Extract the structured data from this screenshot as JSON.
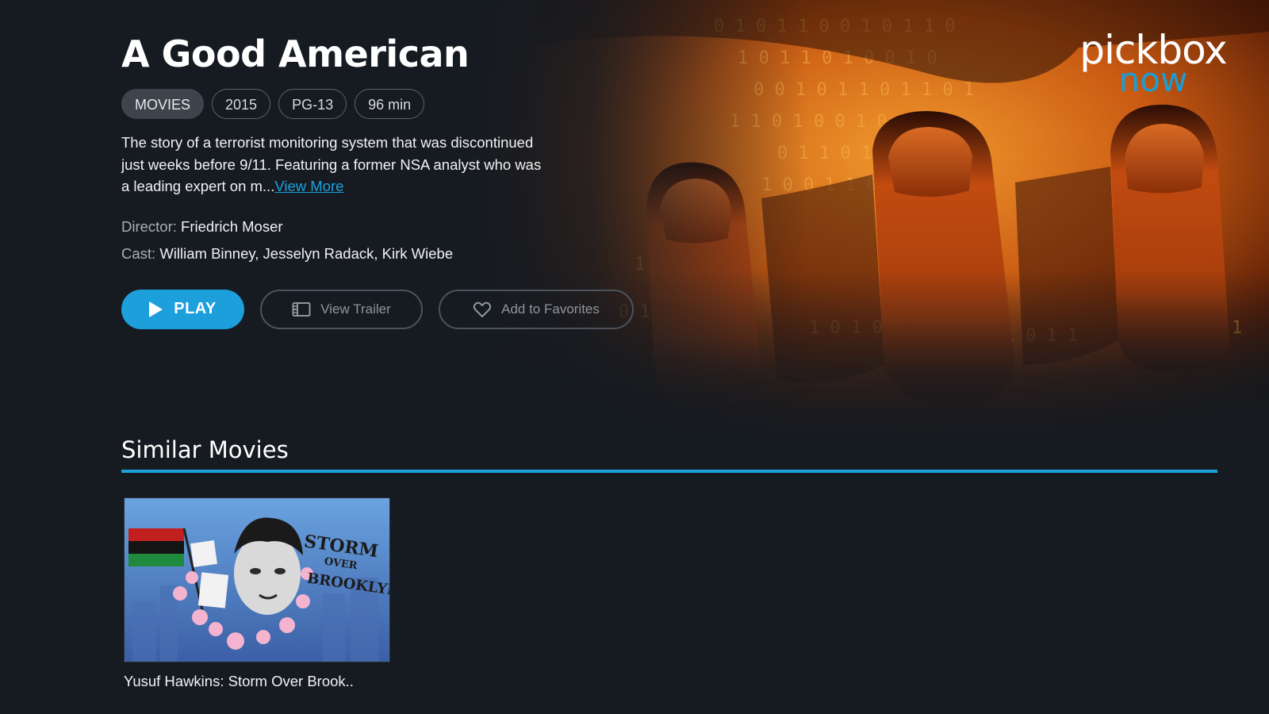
{
  "brand": {
    "logo_primary": "pickbox",
    "logo_secondary": "now",
    "accent_color": "#1d9fdc"
  },
  "movie": {
    "title": "A Good American",
    "tags": [
      "MOVIES",
      "2015",
      "PG-13",
      "96 min"
    ],
    "synopsis": "The story of a terrorist monitoring system that was discontinued just weeks before 9/11. Featuring a former NSA analyst who was a leading expert on m...",
    "view_more_label": "View More",
    "director_label": "Director:",
    "director": "Friedrich Moser",
    "cast_label": "Cast:",
    "cast": "William Binney, Jesselyn Radack, Kirk Wiebe"
  },
  "actions": {
    "play_label": "PLAY",
    "trailer_label": "View Trailer",
    "favorites_label": "Add to Favorites",
    "play_icon": "play-icon",
    "trailer_icon": "film-icon",
    "favorites_icon": "heart-icon"
  },
  "similar": {
    "heading": "Similar Movies",
    "items": [
      {
        "caption": "Yusuf Hawkins: Storm Over Brook..",
        "poster_text": {
          "line1": "STORM",
          "line2": "OVER",
          "line3": "BROOKLYN"
        }
      }
    ]
  }
}
